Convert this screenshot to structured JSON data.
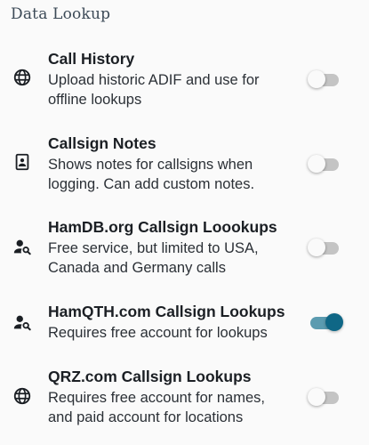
{
  "section": {
    "title": "Data Lookup"
  },
  "items": [
    {
      "title": "Call History",
      "description": "Upload historic ADIF and use for\noffline lookups",
      "icon": "globe-icon",
      "enabled": false
    },
    {
      "title": "Callsign Notes",
      "description": "Shows notes for callsigns when\nlogging. Can add custom notes.",
      "icon": "contact-card-icon",
      "enabled": false
    },
    {
      "title": "HamDB.org Callsign Loookups",
      "description": "Free service, but limited to USA,\nCanada and Germany calls",
      "icon": "person-search-icon",
      "enabled": false
    },
    {
      "title": "HamQTH.com Callsign Lookups",
      "description": "Requires free account for lookups",
      "icon": "person-search-icon",
      "enabled": true
    },
    {
      "title": "QRZ.com Callsign Lookups",
      "description": "Requires free account for names,\nand paid account for locations",
      "icon": "globe-icon",
      "enabled": false
    }
  ],
  "colors": {
    "accent": "#0f6786",
    "accent_track": "#5b9bb0",
    "off_track": "#c4c4c4"
  }
}
